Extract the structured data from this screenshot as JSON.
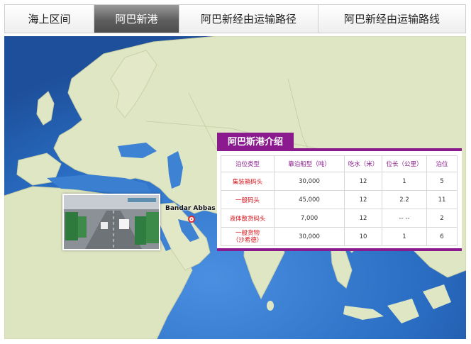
{
  "tabs": [
    {
      "label": "海上区间",
      "active": false
    },
    {
      "label": "阿巴新港",
      "active": true
    },
    {
      "label": "阿巴新经由运输路径",
      "active": false
    },
    {
      "label": "阿巴新经由运输路线",
      "active": false
    }
  ],
  "map": {
    "port_label": "Bandar Abbas"
  },
  "panel": {
    "title": "阿巴斯港介绍",
    "headers": [
      "泊位类型",
      "靠泊船型（吨）",
      "吃水（米）",
      "位长（公里）",
      "泊位"
    ],
    "rows": [
      [
        "集装箱码头",
        "30,000",
        "12",
        "1",
        "5"
      ],
      [
        "一般码头",
        "45,000",
        "12",
        "2.2",
        "11"
      ],
      [
        "液体散货码头",
        "7,000",
        "12",
        "-- --",
        "2"
      ],
      [
        "一般货物\n（沙希德）",
        "30,000",
        "10",
        "1",
        "6"
      ]
    ]
  },
  "colors": {
    "accent": "#8a1a8e",
    "row_label": "#d6161c",
    "ocean": "#2a6ec4",
    "land": "#dfe6c4"
  }
}
